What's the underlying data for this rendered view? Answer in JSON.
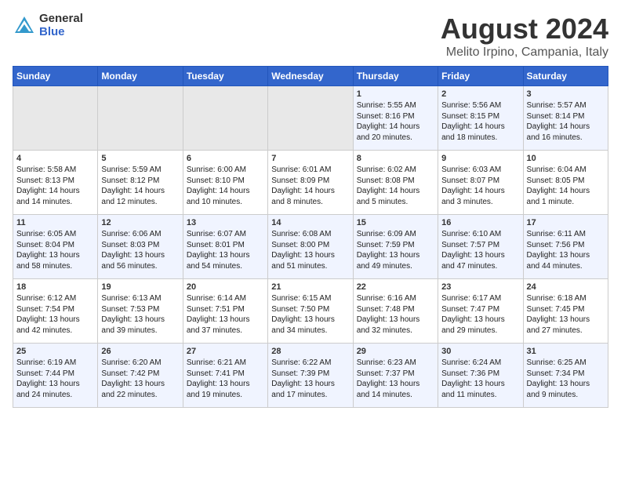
{
  "logo": {
    "general": "General",
    "blue": "Blue"
  },
  "title": "August 2024",
  "subtitle": "Melito Irpino, Campania, Italy",
  "days_of_week": [
    "Sunday",
    "Monday",
    "Tuesday",
    "Wednesday",
    "Thursday",
    "Friday",
    "Saturday"
  ],
  "weeks": [
    [
      {
        "day": "",
        "empty": true
      },
      {
        "day": "",
        "empty": true
      },
      {
        "day": "",
        "empty": true
      },
      {
        "day": "",
        "empty": true
      },
      {
        "day": "1",
        "sunrise": "5:55 AM",
        "sunset": "8:16 PM",
        "daylight": "14 hours and 20 minutes."
      },
      {
        "day": "2",
        "sunrise": "5:56 AM",
        "sunset": "8:15 PM",
        "daylight": "14 hours and 18 minutes."
      },
      {
        "day": "3",
        "sunrise": "5:57 AM",
        "sunset": "8:14 PM",
        "daylight": "14 hours and 16 minutes."
      }
    ],
    [
      {
        "day": "4",
        "sunrise": "5:58 AM",
        "sunset": "8:13 PM",
        "daylight": "14 hours and 14 minutes."
      },
      {
        "day": "5",
        "sunrise": "5:59 AM",
        "sunset": "8:12 PM",
        "daylight": "14 hours and 12 minutes."
      },
      {
        "day": "6",
        "sunrise": "6:00 AM",
        "sunset": "8:10 PM",
        "daylight": "14 hours and 10 minutes."
      },
      {
        "day": "7",
        "sunrise": "6:01 AM",
        "sunset": "8:09 PM",
        "daylight": "14 hours and 8 minutes."
      },
      {
        "day": "8",
        "sunrise": "6:02 AM",
        "sunset": "8:08 PM",
        "daylight": "14 hours and 5 minutes."
      },
      {
        "day": "9",
        "sunrise": "6:03 AM",
        "sunset": "8:07 PM",
        "daylight": "14 hours and 3 minutes."
      },
      {
        "day": "10",
        "sunrise": "6:04 AM",
        "sunset": "8:05 PM",
        "daylight": "14 hours and 1 minute."
      }
    ],
    [
      {
        "day": "11",
        "sunrise": "6:05 AM",
        "sunset": "8:04 PM",
        "daylight": "13 hours and 58 minutes."
      },
      {
        "day": "12",
        "sunrise": "6:06 AM",
        "sunset": "8:03 PM",
        "daylight": "13 hours and 56 minutes."
      },
      {
        "day": "13",
        "sunrise": "6:07 AM",
        "sunset": "8:01 PM",
        "daylight": "13 hours and 54 minutes."
      },
      {
        "day": "14",
        "sunrise": "6:08 AM",
        "sunset": "8:00 PM",
        "daylight": "13 hours and 51 minutes."
      },
      {
        "day": "15",
        "sunrise": "6:09 AM",
        "sunset": "7:59 PM",
        "daylight": "13 hours and 49 minutes."
      },
      {
        "day": "16",
        "sunrise": "6:10 AM",
        "sunset": "7:57 PM",
        "daylight": "13 hours and 47 minutes."
      },
      {
        "day": "17",
        "sunrise": "6:11 AM",
        "sunset": "7:56 PM",
        "daylight": "13 hours and 44 minutes."
      }
    ],
    [
      {
        "day": "18",
        "sunrise": "6:12 AM",
        "sunset": "7:54 PM",
        "daylight": "13 hours and 42 minutes."
      },
      {
        "day": "19",
        "sunrise": "6:13 AM",
        "sunset": "7:53 PM",
        "daylight": "13 hours and 39 minutes."
      },
      {
        "day": "20",
        "sunrise": "6:14 AM",
        "sunset": "7:51 PM",
        "daylight": "13 hours and 37 minutes."
      },
      {
        "day": "21",
        "sunrise": "6:15 AM",
        "sunset": "7:50 PM",
        "daylight": "13 hours and 34 minutes."
      },
      {
        "day": "22",
        "sunrise": "6:16 AM",
        "sunset": "7:48 PM",
        "daylight": "13 hours and 32 minutes."
      },
      {
        "day": "23",
        "sunrise": "6:17 AM",
        "sunset": "7:47 PM",
        "daylight": "13 hours and 29 minutes."
      },
      {
        "day": "24",
        "sunrise": "6:18 AM",
        "sunset": "7:45 PM",
        "daylight": "13 hours and 27 minutes."
      }
    ],
    [
      {
        "day": "25",
        "sunrise": "6:19 AM",
        "sunset": "7:44 PM",
        "daylight": "13 hours and 24 minutes."
      },
      {
        "day": "26",
        "sunrise": "6:20 AM",
        "sunset": "7:42 PM",
        "daylight": "13 hours and 22 minutes."
      },
      {
        "day": "27",
        "sunrise": "6:21 AM",
        "sunset": "7:41 PM",
        "daylight": "13 hours and 19 minutes."
      },
      {
        "day": "28",
        "sunrise": "6:22 AM",
        "sunset": "7:39 PM",
        "daylight": "13 hours and 17 minutes."
      },
      {
        "day": "29",
        "sunrise": "6:23 AM",
        "sunset": "7:37 PM",
        "daylight": "13 hours and 14 minutes."
      },
      {
        "day": "30",
        "sunrise": "6:24 AM",
        "sunset": "7:36 PM",
        "daylight": "13 hours and 11 minutes."
      },
      {
        "day": "31",
        "sunrise": "6:25 AM",
        "sunset": "7:34 PM",
        "daylight": "13 hours and 9 minutes."
      }
    ]
  ],
  "labels": {
    "sunrise_prefix": "Sunrise: ",
    "sunset_prefix": "Sunset: ",
    "daylight_prefix": "Daylight: "
  }
}
